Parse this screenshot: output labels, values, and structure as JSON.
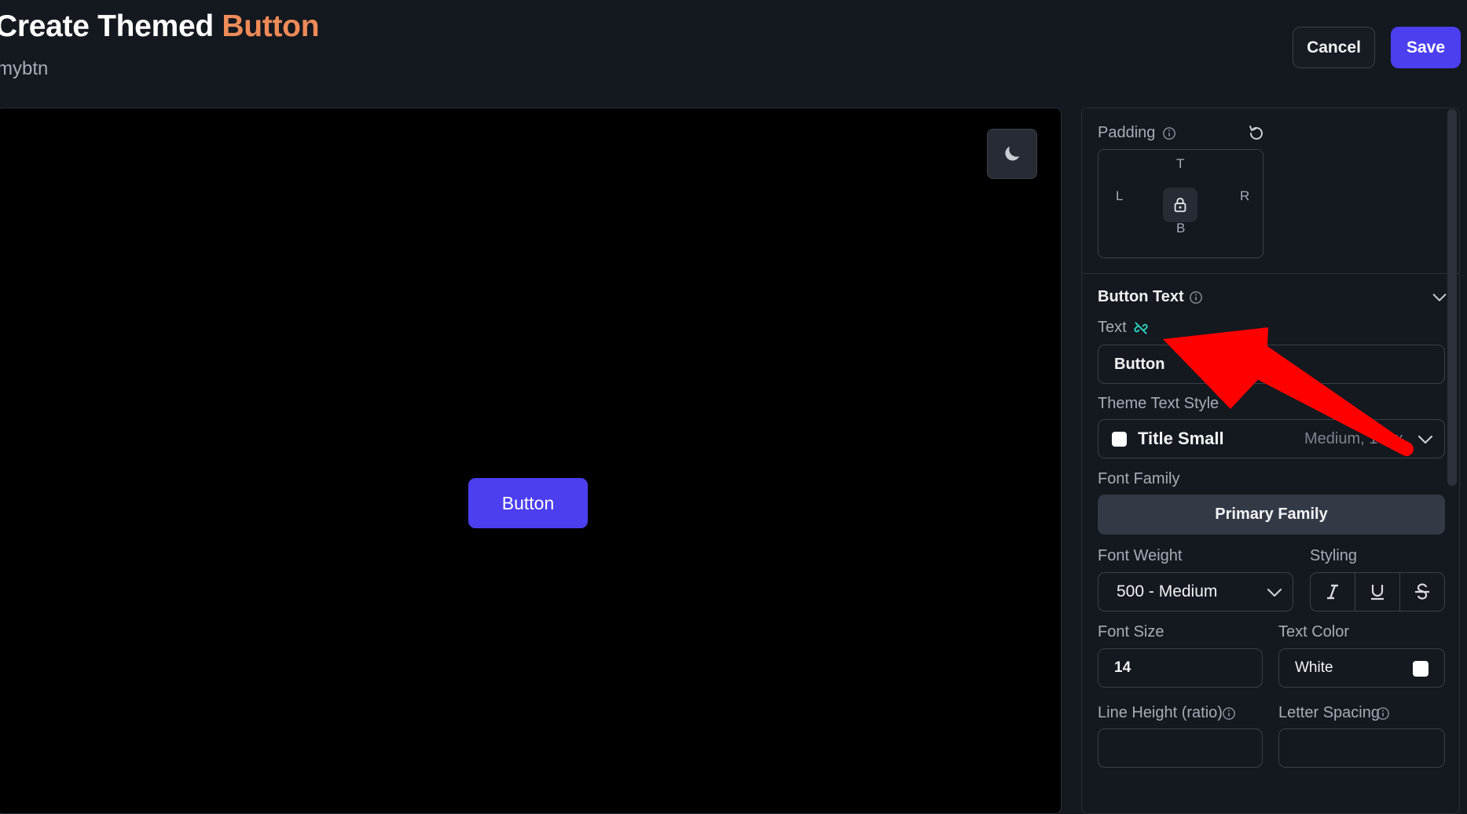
{
  "header": {
    "title_prefix": "Create Themed",
    "title_accent": "Button",
    "subtitle": "mybtn",
    "cancel_label": "Cancel",
    "save_label": "Save"
  },
  "canvas": {
    "preview_button_label": "Button",
    "theme_toggle_icon": "moon-icon"
  },
  "panel": {
    "padding": {
      "label": "Padding",
      "top": "T",
      "left": "L",
      "right": "R",
      "bottom": "B"
    },
    "button_text": {
      "section_title": "Button Text",
      "text_label": "Text",
      "text_value": "Button",
      "theme_text_style_label": "Theme Text Style",
      "theme_text_style_value": "Title Small",
      "theme_text_style_meta": "Medium, 14px",
      "font_family_label": "Font Family",
      "font_family_value": "Primary Family",
      "font_weight_label": "Font Weight",
      "font_weight_value": "500 - Medium",
      "styling_label": "Styling",
      "font_size_label": "Font Size",
      "font_size_value": "14",
      "text_color_label": "Text Color",
      "text_color_value": "White",
      "line_height_label": "Line Height (ratio)",
      "letter_spacing_label": "Letter Spacing"
    }
  },
  "colors": {
    "accent_orange": "#ee8b58",
    "primary": "#4b3ff0",
    "annotation_arrow": "#ff0000"
  }
}
